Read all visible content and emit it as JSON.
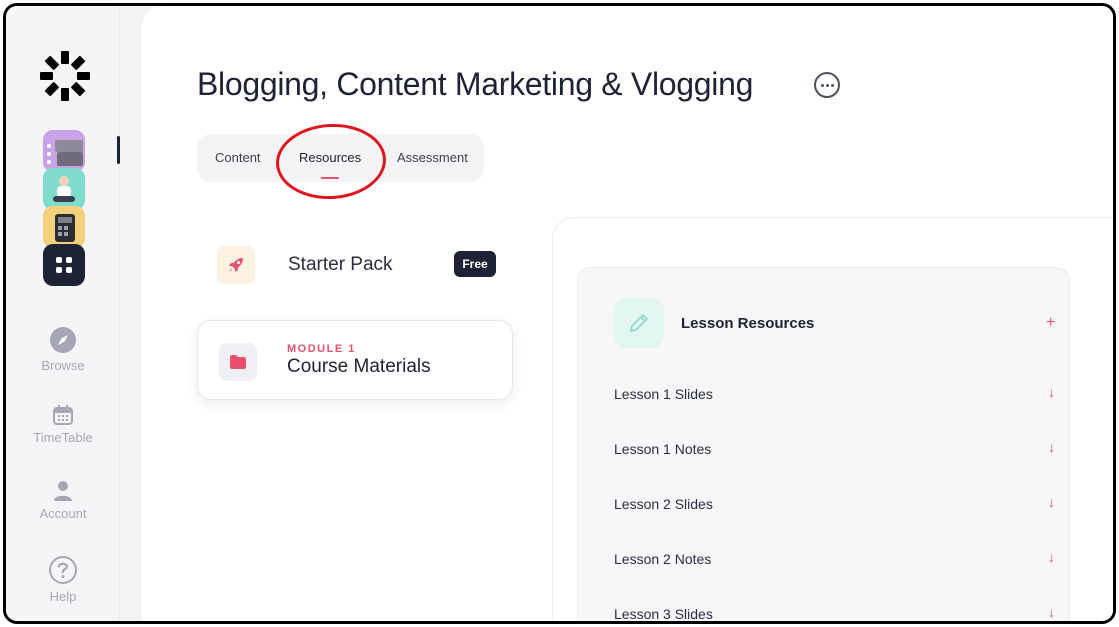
{
  "colors": {
    "accent": "#e8506e",
    "dark": "#1e2235",
    "highlight_ring": "#e0161f"
  },
  "sidebar": {
    "logo_icon": "circle-ring-logo-icon",
    "apps": [
      {
        "name": "typewriter-app-tile",
        "color": "#c9a3e8"
      },
      {
        "name": "person-app-tile",
        "color": "#7fdccc"
      },
      {
        "name": "calculator-app-tile",
        "color": "#f3d07a"
      },
      {
        "name": "all-apps-grid-tile",
        "color": "#1e2235"
      }
    ],
    "nav": [
      {
        "label": "Browse",
        "icon": "compass-icon"
      },
      {
        "label": "TimeTable",
        "icon": "calendar-icon"
      },
      {
        "label": "Account",
        "icon": "user-icon"
      },
      {
        "label": "Help",
        "icon": "help-circle-icon"
      }
    ]
  },
  "header": {
    "title": "Blogging, Content Marketing & Vlogging",
    "more_icon": "more-horizontal-icon"
  },
  "tabs": [
    {
      "label": "Content",
      "active": false
    },
    {
      "label": "Resources",
      "active": true
    },
    {
      "label": "Assessment",
      "active": false
    }
  ],
  "course": {
    "starter": {
      "label": "Starter Pack",
      "badge": "Free",
      "icon": "rocket-icon"
    },
    "module": {
      "tag": "MODULE 1",
      "title": "Course Materials",
      "icon": "folder-icon"
    }
  },
  "resources": {
    "title": "Lesson Resources",
    "icon": "pencil-icon",
    "add_symbol": "+",
    "download_symbol": "↓",
    "items": [
      "Lesson 1 Slides",
      "Lesson 1 Notes",
      "Lesson 2 Slides",
      "Lesson 2 Notes",
      "Lesson 3 Slides"
    ]
  }
}
